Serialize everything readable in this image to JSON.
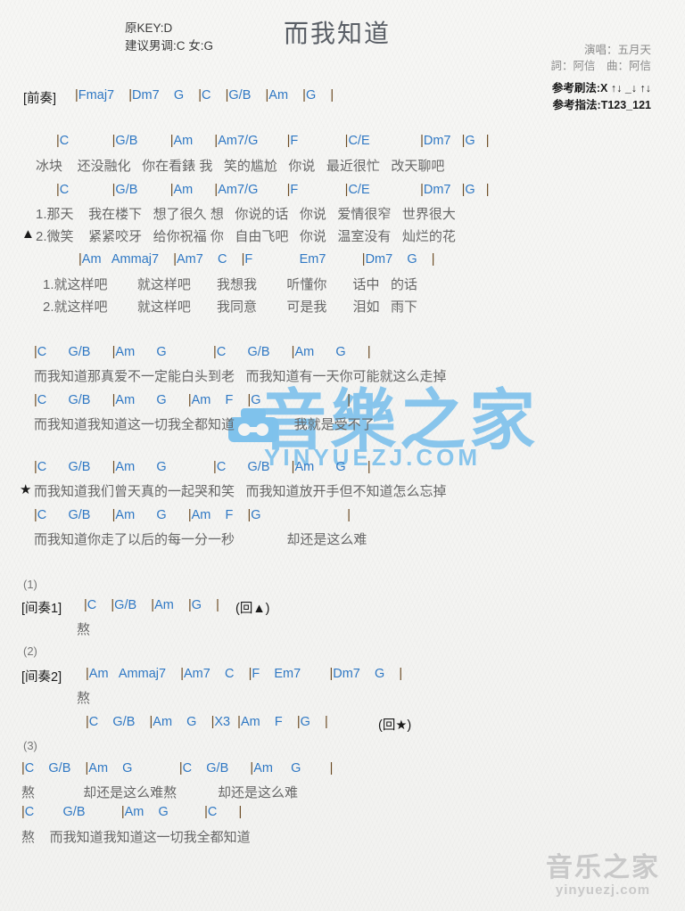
{
  "header": {
    "title": "而我知道",
    "key_line": "原KEY:D",
    "suggest_line": "建议男调:C 女:G",
    "singer": "演唱：五月天",
    "writer": "詞：阿信　曲：阿信",
    "strum": "参考刷法:X ↑↓ _↓ ↑↓",
    "picking": "参考指法:T123_121"
  },
  "intro": {
    "tag": "[前奏]",
    "chords": "|Fmaj7    |Dm7    G    |C    |G/B    |Am    |G    |"
  },
  "verse1": {
    "chords": "|C            |G/B         |Am      |Am7/G        |F             |C/E              |Dm7   |G   |",
    "lyrics": "冰块    还没融化   你在看錶 我   笑的尴尬   你说   最近很忙   改天聊吧"
  },
  "verse2": {
    "chords": "|C            |G/B         |Am      |Am7/G        |F             |C/E              |Dm7   |G   |",
    "lyrics_1": "1.那天    我在楼下   想了很久 想   你说的话   你说   爱情很窄   世界很大",
    "lyrics_2_marker": "▲",
    "lyrics_2": "2.微笑    紧紧咬牙   给你祝福 你   自由飞吧   你说   温室没有   灿烂的花"
  },
  "prechorus": {
    "chords": "|Am   Ammaj7    |Am7    C    |F             Em7          |Dm7    G    |",
    "lyrics_1": "1.就这样吧        就这样吧       我想我        听懂你       话中   的话",
    "lyrics_2": "2.就这样吧        就这样吧       我同意        可是我       泪如   雨下"
  },
  "chorus": [
    {
      "chords": "|C      G/B      |Am      G             |C      G/B      |Am      G      |",
      "lyrics": "而我知道那真爱不一定能白头到老   而我知道有一天你可能就这么走掉",
      "marker": ""
    },
    {
      "chords": "|C      G/B      |Am      G      |Am    F    |G                        |",
      "lyrics": "而我知道我知道这一切我全都知道                我就是受不了",
      "marker": ""
    }
  ],
  "chorus2": [
    {
      "chords": "|C      G/B      |Am      G             |C      G/B      |Am      G      |",
      "lyrics": "而我知道我们曾天真的一起哭和笑   而我知道放开手但不知道怎么忘掉",
      "marker": "★"
    },
    {
      "chords": "|C      G/B      |Am      G      |Am    F    |G                        |",
      "lyrics": "而我知道你走了以后的每一分一秒              却还是这么难",
      "marker": ""
    }
  ],
  "interlude1": {
    "num": "(1)",
    "tag": "[间奏1]",
    "chords": "|C    |G/B    |Am    |G    |",
    "repeat": "(回▲)",
    "lyric": "熬"
  },
  "interlude2": {
    "num": "(2)",
    "tag": "[间奏2]",
    "chords": "|Am   Ammaj7    |Am7    C    |F    Em7        |Dm7    G    |",
    "lyric": "熬",
    "chords_b": "|C    G/B    |Am    G    |X3  |Am    F    |G    |",
    "repeat_b": "(回★)"
  },
  "ending": {
    "num": "(3)",
    "line1_chords": "|C    G/B    |Am    G             |C    G/B      |Am     G        |",
    "line1_lyrics": "熬             却还是这么难熬           却还是这么难",
    "line2_chords": "|C        G/B          |Am    G          |C      |",
    "line2_lyrics": "熬    而我知道我知道这一切我全都知道"
  },
  "watermarks": {
    "center_cn": "音樂之家",
    "center_en": "YINYUEZJ.COM",
    "corner_cn": "音乐之家",
    "corner_en": "yinyuezj.com"
  },
  "colors": {
    "chord_blue": "#2f78c4",
    "bar_brown": "#6b4a22",
    "lyric_gray": "#666666",
    "watermark_blue": "#7fc2ec",
    "watermark_gray": "#c9c9c9"
  }
}
